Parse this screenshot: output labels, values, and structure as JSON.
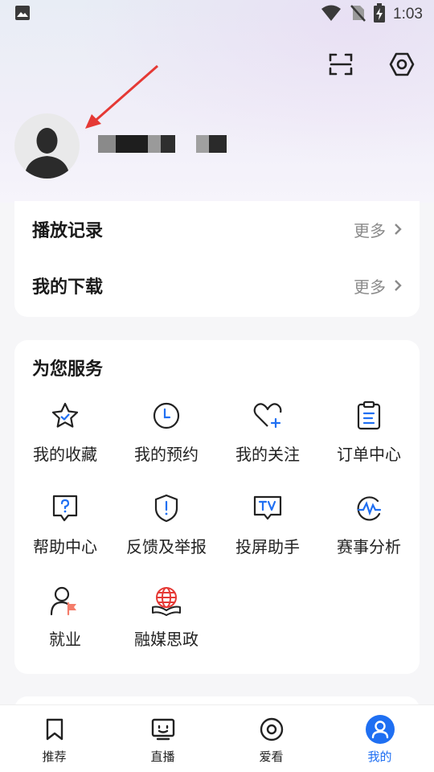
{
  "status_bar": {
    "time": "1:03"
  },
  "history": [
    {
      "title": "播放记录",
      "more": "更多"
    },
    {
      "title": "我的下载",
      "more": "更多"
    }
  ],
  "services": {
    "title": "为您服务",
    "items": [
      {
        "label": "我的收藏",
        "icon": "star-check-icon"
      },
      {
        "label": "我的预约",
        "icon": "clock-icon"
      },
      {
        "label": "我的关注",
        "icon": "heart-plus-icon"
      },
      {
        "label": "订单中心",
        "icon": "clipboard-icon"
      },
      {
        "label": "帮助中心",
        "icon": "help-bubble-icon"
      },
      {
        "label": "反馈及举报",
        "icon": "shield-alert-icon"
      },
      {
        "label": "投屏助手",
        "icon": "tv-cast-icon"
      },
      {
        "label": "赛事分析",
        "icon": "analysis-icon"
      },
      {
        "label": "就业",
        "icon": "employment-icon"
      },
      {
        "label": "融媒思政",
        "icon": "globe-book-icon"
      }
    ]
  },
  "tabs": [
    {
      "label": "推荐",
      "icon": "bookmark-icon"
    },
    {
      "label": "直播",
      "icon": "tv-face-icon"
    },
    {
      "label": "爱看",
      "icon": "target-icon"
    },
    {
      "label": "我的",
      "icon": "person-icon",
      "active": true
    }
  ],
  "colors": {
    "accent": "#1f6ff2",
    "annotation_arrow": "#e53935",
    "employment_flag": "#f47c6a",
    "globe_red": "#e53935"
  }
}
